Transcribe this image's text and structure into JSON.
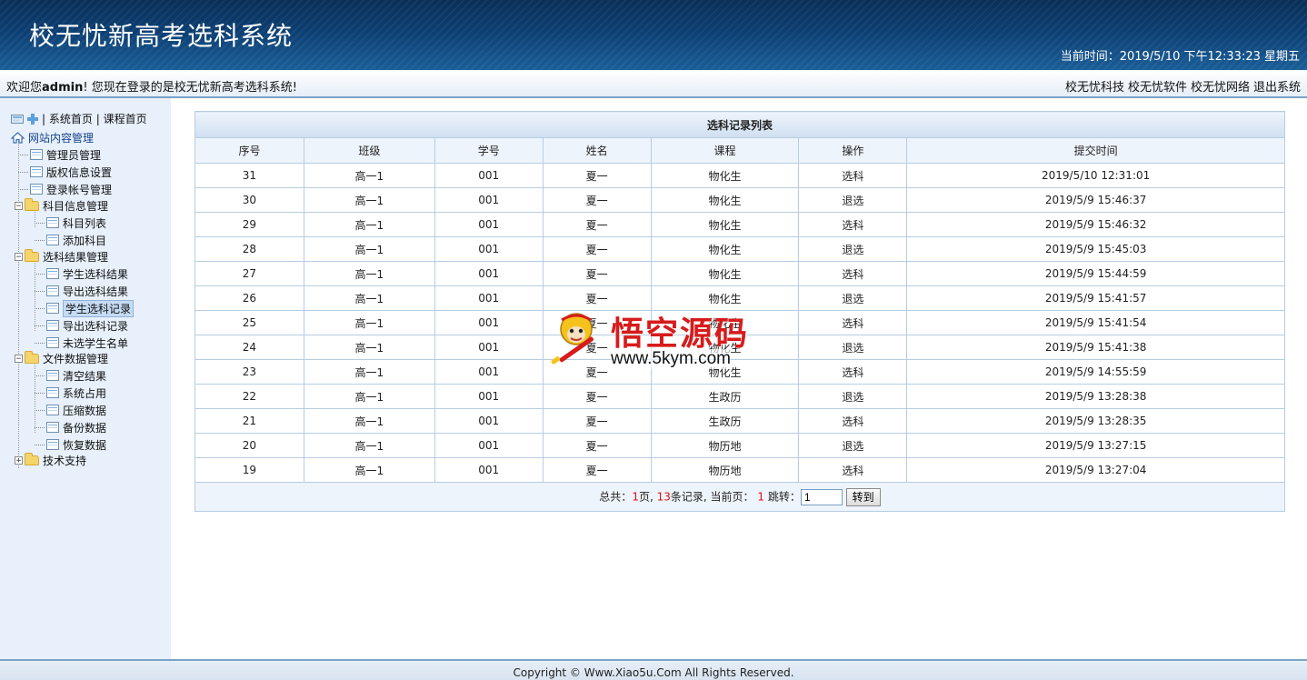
{
  "header": {
    "title": "校无忧新高考选科系统",
    "clock": "当前时间：2019/5/10 下午12:33:23 星期五"
  },
  "welcome": {
    "prefix": "欢迎您",
    "user": "admin",
    "suffix": "! 您现在登录的是校无忧新高考选科系统!",
    "links": [
      "校无忧科技",
      "校无忧软件",
      "校无忧网络",
      "退出系统"
    ]
  },
  "sidebar": {
    "top_links": [
      "系统首页",
      "课程首页"
    ],
    "separator": "|",
    "root": "网站内容管理",
    "items": [
      {
        "label": "管理员管理"
      },
      {
        "label": "版权信息设置"
      },
      {
        "label": "登录帐号管理"
      },
      {
        "label": "科目信息管理",
        "children": [
          "科目列表",
          "添加科目"
        ]
      },
      {
        "label": "选科结果管理",
        "children": [
          "学生选科结果",
          "导出选科结果",
          "学生选科记录",
          "导出选科记录",
          "未选学生名单"
        ]
      },
      {
        "label": "文件数据管理",
        "children": [
          "清空结果",
          "系统占用",
          "压缩数据",
          "备份数据",
          "恢复数据"
        ]
      },
      {
        "label": "技术支持"
      }
    ],
    "selected": "学生选科记录"
  },
  "table": {
    "caption": "选科记录列表",
    "columns": [
      "序号",
      "班级",
      "学号",
      "姓名",
      "课程",
      "操作",
      "提交时间"
    ],
    "rows": [
      [
        "31",
        "高一1",
        "001",
        "夏一",
        "物化生",
        "选科",
        "2019/5/10 12:31:01"
      ],
      [
        "30",
        "高一1",
        "001",
        "夏一",
        "物化生",
        "退选",
        "2019/5/9 15:46:37"
      ],
      [
        "29",
        "高一1",
        "001",
        "夏一",
        "物化生",
        "选科",
        "2019/5/9 15:46:32"
      ],
      [
        "28",
        "高一1",
        "001",
        "夏一",
        "物化生",
        "退选",
        "2019/5/9 15:45:03"
      ],
      [
        "27",
        "高一1",
        "001",
        "夏一",
        "物化生",
        "选科",
        "2019/5/9 15:44:59"
      ],
      [
        "26",
        "高一1",
        "001",
        "夏一",
        "物化生",
        "退选",
        "2019/5/9 15:41:57"
      ],
      [
        "25",
        "高一1",
        "001",
        "夏一",
        "物化生",
        "选科",
        "2019/5/9 15:41:54"
      ],
      [
        "24",
        "高一1",
        "001",
        "夏一",
        "物化生",
        "退选",
        "2019/5/9 15:41:38"
      ],
      [
        "23",
        "高一1",
        "001",
        "夏一",
        "物化生",
        "选科",
        "2019/5/9 14:55:59"
      ],
      [
        "22",
        "高一1",
        "001",
        "夏一",
        "生政历",
        "退选",
        "2019/5/9 13:28:38"
      ],
      [
        "21",
        "高一1",
        "001",
        "夏一",
        "生政历",
        "选科",
        "2019/5/9 13:28:35"
      ],
      [
        "20",
        "高一1",
        "001",
        "夏一",
        "物历地",
        "退选",
        "2019/5/9 13:27:15"
      ],
      [
        "19",
        "高一1",
        "001",
        "夏一",
        "物历地",
        "选科",
        "2019/5/9 13:27:04"
      ]
    ],
    "op_colors": {
      "选科": "#222222",
      "退选": "#e01010"
    }
  },
  "pager": {
    "total_label": "总共：",
    "pages": "1",
    "pages_suffix": "页,",
    "records": "13",
    "records_suffix": "条记录, 当前页：",
    "current": "1",
    "jump_label": "跳转：",
    "jump_value": "1",
    "go_label": "转到"
  },
  "watermark": {
    "cn": "悟空源码",
    "url": "www.5kym.com"
  },
  "footer": {
    "copyright": "Copyright © Www.Xiao5u.Com All Rights Reserved."
  }
}
